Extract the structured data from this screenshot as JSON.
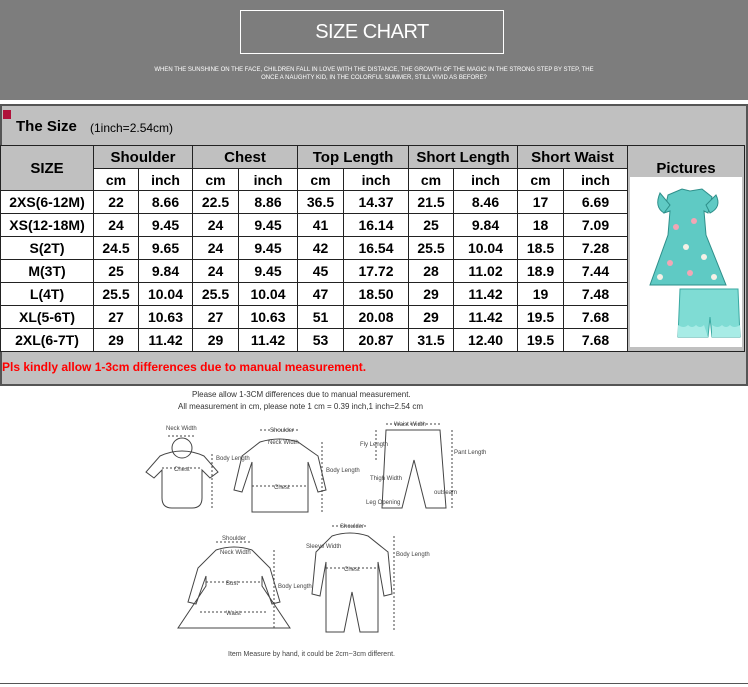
{
  "banner": {
    "title": "SIZE CHART",
    "subtitle": "WHEN THE SUNSHINE ON THE FACE, CHILDREN FALL IN LOVE WITH THE DISTANCE, THE GROWTH OF THE MAGIC IN THE STRONG STEP BY STEP, THE ONCE A NAUGHTY KID, IN THE COLORFUL SUMMER, STILL VIVID AS BEFORE?"
  },
  "size_table": {
    "title": "The Size",
    "unit_note": "(1inch=2.54cm)",
    "headers": {
      "size": "SIZE",
      "shoulder": "Shoulder",
      "chest": "Chest",
      "top_length": "Top Length",
      "short_length": "Short Length",
      "short_waist": "Short Waist",
      "pictures": "Pictures"
    },
    "units": {
      "cm": "cm",
      "inch": "inch"
    },
    "rows": [
      {
        "size": "2XS(6-12M)",
        "v": [
          "22",
          "8.66",
          "22.5",
          "8.86",
          "36.5",
          "14.37",
          "21.5",
          "8.46",
          "17",
          "6.69"
        ]
      },
      {
        "size": "XS(12-18M)",
        "v": [
          "24",
          "9.45",
          "24",
          "9.45",
          "41",
          "16.14",
          "25",
          "9.84",
          "18",
          "7.09"
        ]
      },
      {
        "size": "S(2T)",
        "v": [
          "24.5",
          "9.65",
          "24",
          "9.45",
          "42",
          "16.54",
          "25.5",
          "10.04",
          "18.5",
          "7.28"
        ]
      },
      {
        "size": "M(3T)",
        "v": [
          "25",
          "9.84",
          "24",
          "9.45",
          "45",
          "17.72",
          "28",
          "11.02",
          "18.9",
          "7.44"
        ]
      },
      {
        "size": "L(4T)",
        "v": [
          "25.5",
          "10.04",
          "25.5",
          "10.04",
          "47",
          "18.50",
          "29",
          "11.42",
          "19",
          "7.48"
        ]
      },
      {
        "size": "XL(5-6T)",
        "v": [
          "27",
          "10.63",
          "27",
          "10.63",
          "51",
          "20.08",
          "29",
          "11.42",
          "19.5",
          "7.68"
        ]
      },
      {
        "size": "2XL(6-7T)",
        "v": [
          "29",
          "11.42",
          "29",
          "11.42",
          "53",
          "20.87",
          "31.5",
          "12.40",
          "19.5",
          "7.68"
        ]
      }
    ],
    "note": "Pls kindly allow 1-3cm differences due to manual measurement."
  },
  "measure_guide": {
    "line1": "Please allow 1-3CM differences due to manual measurement.",
    "line2": "All measurement in cm, please note 1 cm = 0.39 inch,1 inch=2.54 cm",
    "footer": "Item Measure by hand, it could be 2cm~3cm different.",
    "labels": {
      "neck_width": "Neck Width",
      "shoulder": "Shoulder",
      "chest": "Chest",
      "body_length": "Body Length",
      "waist_width": "Waist Width",
      "fly_length": "Fly Length",
      "pant_length": "Pant Length",
      "thigh_width": "Thigh Width",
      "outseam": "outseam",
      "leg_opening": "Leg Opening",
      "bust": "Bust",
      "waist": "Waist",
      "sleeve_width": "Sleeve Width"
    }
  },
  "colors": {
    "banner_bg": "#7d7d7d",
    "panel_bg": "#c0c0c0",
    "note_red": "#ff0000",
    "garment_teal": "#4fc3c0"
  }
}
